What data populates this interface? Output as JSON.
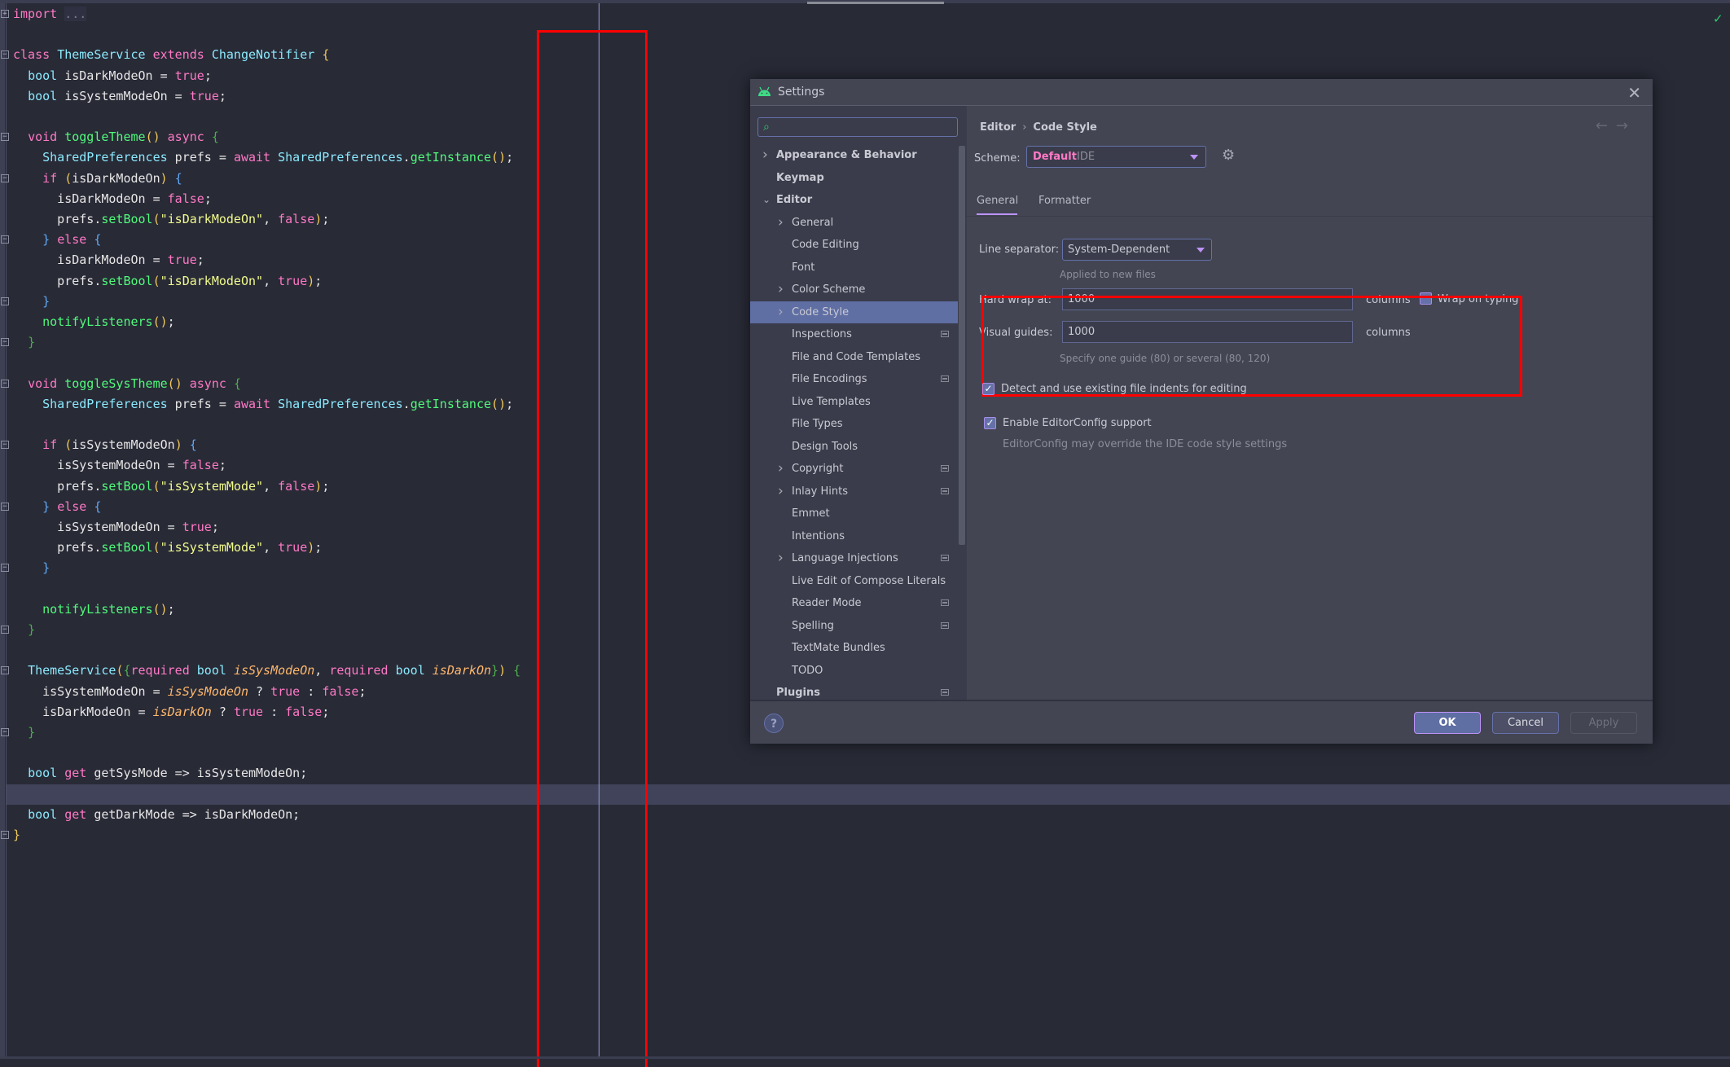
{
  "editor": {
    "code_lines": [
      {
        "text": "import ...",
        "fold": "plus"
      },
      {
        "text": "",
        "fold": null
      },
      {
        "text": "class ThemeService extends ChangeNotifier {",
        "fold": "minus"
      },
      {
        "text": "  bool isDarkModeOn = true;",
        "fold": null
      },
      {
        "text": "  bool isSystemModeOn = true;",
        "fold": null
      },
      {
        "text": "",
        "fold": null
      },
      {
        "text": "  void toggleTheme() async {",
        "fold": "minus"
      },
      {
        "text": "    SharedPreferences prefs = await SharedPreferences.getInstance();",
        "fold": null
      },
      {
        "text": "    if (isDarkModeOn) {",
        "fold": "minus"
      },
      {
        "text": "      isDarkModeOn = false;",
        "fold": null
      },
      {
        "text": "      prefs.setBool(\"isDarkModeOn\", false);",
        "fold": null
      },
      {
        "text": "    } else {",
        "fold": "end"
      },
      {
        "text": "      isDarkModeOn = true;",
        "fold": null
      },
      {
        "text": "      prefs.setBool(\"isDarkModeOn\", true);",
        "fold": null
      },
      {
        "text": "    }",
        "fold": "end"
      },
      {
        "text": "    notifyListeners();",
        "fold": null
      },
      {
        "text": "  }",
        "fold": "end"
      },
      {
        "text": "",
        "fold": null
      },
      {
        "text": "  void toggleSysTheme() async {",
        "fold": "minus"
      },
      {
        "text": "    SharedPreferences prefs = await SharedPreferences.getInstance();",
        "fold": null
      },
      {
        "text": "",
        "fold": null
      },
      {
        "text": "    if (isSystemModeOn) {",
        "fold": "minus"
      },
      {
        "text": "      isSystemModeOn = false;",
        "fold": null
      },
      {
        "text": "      prefs.setBool(\"isSystemMode\", false);",
        "fold": null
      },
      {
        "text": "    } else {",
        "fold": "end"
      },
      {
        "text": "      isSystemModeOn = true;",
        "fold": null
      },
      {
        "text": "      prefs.setBool(\"isSystemMode\", true);",
        "fold": null
      },
      {
        "text": "    }",
        "fold": "end"
      },
      {
        "text": "",
        "fold": null
      },
      {
        "text": "    notifyListeners();",
        "fold": null
      },
      {
        "text": "  }",
        "fold": "end"
      },
      {
        "text": "",
        "fold": null
      },
      {
        "text": "  ThemeService({required bool isSysModeOn, required bool isDarkOn}) {",
        "fold": "minus"
      },
      {
        "text": "    isSystemModeOn = isSysModeOn ? true : false;",
        "fold": null
      },
      {
        "text": "    isDarkModeOn = isDarkOn ? true : false;",
        "fold": null
      },
      {
        "text": "  }",
        "fold": "end"
      },
      {
        "text": "",
        "fold": null
      },
      {
        "text": "  bool get getSysMode => isSystemModeOn;",
        "fold": null
      },
      {
        "text": "",
        "fold": null,
        "current": true
      },
      {
        "text": "  bool get getDarkMode => isDarkModeOn;",
        "fold": null
      },
      {
        "text": "}",
        "fold": "end"
      }
    ],
    "status_icon": "check-icon",
    "colors": {
      "keyword": "#ff79c6",
      "type": "#8be9fd",
      "function": "#50fa7b",
      "string": "#f1fa8c",
      "param": "#ffb86c",
      "annotation_box": "#ff0000"
    }
  },
  "dialog": {
    "title": "Settings",
    "search": {
      "value": "",
      "placeholder": ""
    },
    "tree": [
      {
        "label": "Appearance & Behavior",
        "level": 0,
        "bold": true,
        "chevron": "right",
        "badge": false
      },
      {
        "label": "Keymap",
        "level": 0,
        "bold": true,
        "chevron": null,
        "badge": false
      },
      {
        "label": "Editor",
        "level": 0,
        "bold": true,
        "chevron": "down",
        "badge": false
      },
      {
        "label": "General",
        "level": 1,
        "bold": false,
        "chevron": "right",
        "badge": false
      },
      {
        "label": "Code Editing",
        "level": 1,
        "bold": false,
        "chevron": null,
        "badge": false
      },
      {
        "label": "Font",
        "level": 1,
        "bold": false,
        "chevron": null,
        "badge": false
      },
      {
        "label": "Color Scheme",
        "level": 1,
        "bold": false,
        "chevron": "right",
        "badge": false
      },
      {
        "label": "Code Style",
        "level": 1,
        "bold": false,
        "chevron": "right",
        "badge": false,
        "selected": true
      },
      {
        "label": "Inspections",
        "level": 1,
        "bold": false,
        "chevron": null,
        "badge": true
      },
      {
        "label": "File and Code Templates",
        "level": 1,
        "bold": false,
        "chevron": null,
        "badge": false
      },
      {
        "label": "File Encodings",
        "level": 1,
        "bold": false,
        "chevron": null,
        "badge": true
      },
      {
        "label": "Live Templates",
        "level": 1,
        "bold": false,
        "chevron": null,
        "badge": false
      },
      {
        "label": "File Types",
        "level": 1,
        "bold": false,
        "chevron": null,
        "badge": false
      },
      {
        "label": "Design Tools",
        "level": 1,
        "bold": false,
        "chevron": null,
        "badge": false
      },
      {
        "label": "Copyright",
        "level": 1,
        "bold": false,
        "chevron": "right",
        "badge": true
      },
      {
        "label": "Inlay Hints",
        "level": 1,
        "bold": false,
        "chevron": "right",
        "badge": true
      },
      {
        "label": "Emmet",
        "level": 1,
        "bold": false,
        "chevron": null,
        "badge": false
      },
      {
        "label": "Intentions",
        "level": 1,
        "bold": false,
        "chevron": null,
        "badge": false
      },
      {
        "label": "Language Injections",
        "level": 1,
        "bold": false,
        "chevron": "right",
        "badge": true
      },
      {
        "label": "Live Edit of Compose Literals",
        "level": 1,
        "bold": false,
        "chevron": null,
        "badge": false
      },
      {
        "label": "Reader Mode",
        "level": 1,
        "bold": false,
        "chevron": null,
        "badge": true
      },
      {
        "label": "Spelling",
        "level": 1,
        "bold": false,
        "chevron": null,
        "badge": true
      },
      {
        "label": "TextMate Bundles",
        "level": 1,
        "bold": false,
        "chevron": null,
        "badge": false
      },
      {
        "label": "TODO",
        "level": 1,
        "bold": false,
        "chevron": null,
        "badge": false
      },
      {
        "label": "Plugins",
        "level": 0,
        "bold": true,
        "chevron": null,
        "badge": true
      }
    ],
    "breadcrumb": {
      "parent": "Editor",
      "separator": "›",
      "current": "Code Style"
    },
    "nav": {
      "back": "←",
      "forward": "→"
    },
    "scheme": {
      "label": "Scheme:",
      "name": "Default",
      "sub": "IDE"
    },
    "tabs": [
      {
        "label": "General",
        "active": true
      },
      {
        "label": "Formatter",
        "active": false
      }
    ],
    "line_separator": {
      "label": "Line separator:",
      "value": "System-Dependent",
      "hint": "Applied to new files"
    },
    "hard_wrap": {
      "label": "Hard wrap at:",
      "value": "1000",
      "unit": "columns"
    },
    "wrap_on_typing": {
      "label": "Wrap on typing",
      "checked": false
    },
    "visual_guides": {
      "label": "Visual guides:",
      "value": "1000",
      "unit": "columns",
      "hint": "Specify one guide (80) or several (80, 120)"
    },
    "detect_indents": {
      "label": "Detect and use existing file indents for editing",
      "checked": true
    },
    "editorconfig": {
      "label": "Enable EditorConfig support",
      "checked": true,
      "hint": "EditorConfig may override the IDE code style settings"
    },
    "buttons": {
      "help": "?",
      "ok": "OK",
      "cancel": "Cancel",
      "apply": "Apply"
    },
    "check_glyph": "✓"
  }
}
